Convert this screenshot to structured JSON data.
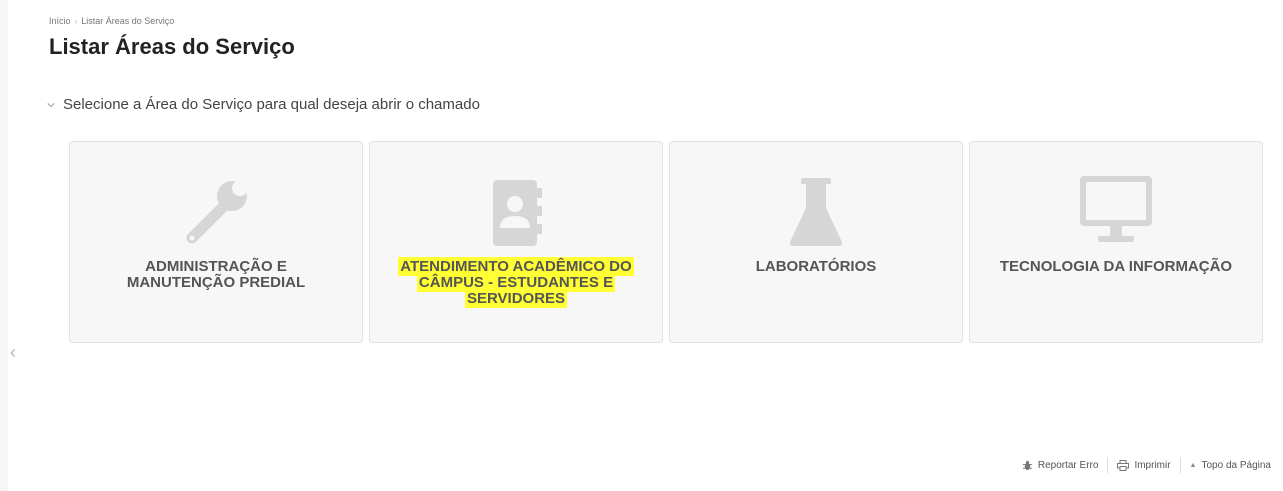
{
  "breadcrumb": {
    "home": "Início",
    "current": "Listar Áreas do Serviço"
  },
  "page": {
    "title": "Listar Áreas do Serviço"
  },
  "section": {
    "label": "Selecione a Área do Serviço para qual deseja abrir o chamado"
  },
  "cards": [
    {
      "title": "ADMINISTRAÇÃO E MANUTENÇÃO PREDIAL",
      "icon": "wrench-icon",
      "highlighted": false
    },
    {
      "title": "ATENDIMENTO ACADÊMICO DO CÂMPUS - ESTUDANTES E SERVIDORES",
      "icon": "contact-book-icon",
      "highlighted": true
    },
    {
      "title": "LABORATÓRIOS",
      "icon": "flask-icon",
      "highlighted": false
    },
    {
      "title": "TECNOLOGIA DA INFORMAÇÃO",
      "icon": "monitor-icon",
      "highlighted": false
    }
  ],
  "footer": {
    "report_error": "Reportar Erro",
    "print": "Imprimir",
    "back_to_top": "Topo da Página"
  },
  "colors": {
    "highlight": "#ffff33",
    "icon": "#d6d6d6",
    "card_bg": "#f7f7f7"
  }
}
